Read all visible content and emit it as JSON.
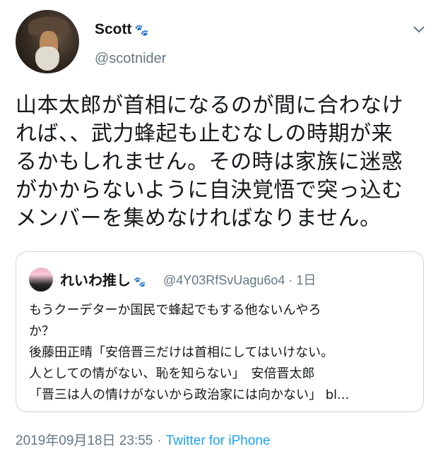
{
  "tweet": {
    "display_name": "Scott",
    "handle": "@scotnider",
    "text_lines": [
      "山本太郎が首相になるのが間に合わなけ",
      "れば、、武力蜂起も止むなしの時期が来",
      "るかもしれません。その時は家族に迷惑",
      "がかからないように自決覚悟で突っ込む",
      "メンバーを集めなければなりません。"
    ],
    "timestamp": "2019年09月18日 23:55",
    "separator": "·",
    "source": "Twitter for iPhone"
  },
  "quoted": {
    "display_name": "れいわ推し",
    "meta": "@4Y03RfSvUagu6o4 · 1日",
    "text_lines": [
      "もうクーデターか国民で蜂起でもする他ないんやろ",
      "か？",
      "後藤田正晴「安倍晋三だけは首相にしてはいけない。",
      "人としての情がない、恥を知らない」　安倍晋太郎",
      "「晋三は人の情けがないから政治家には向かない」 bl..."
    ]
  },
  "icons": {
    "paw": "🐾",
    "more": "chevron-down-icon"
  },
  "colors": {
    "text": "#14171a",
    "secondary": "#657786",
    "link": "#1da1f2",
    "border": "#ccd6dd",
    "paw": "#e2264d"
  }
}
